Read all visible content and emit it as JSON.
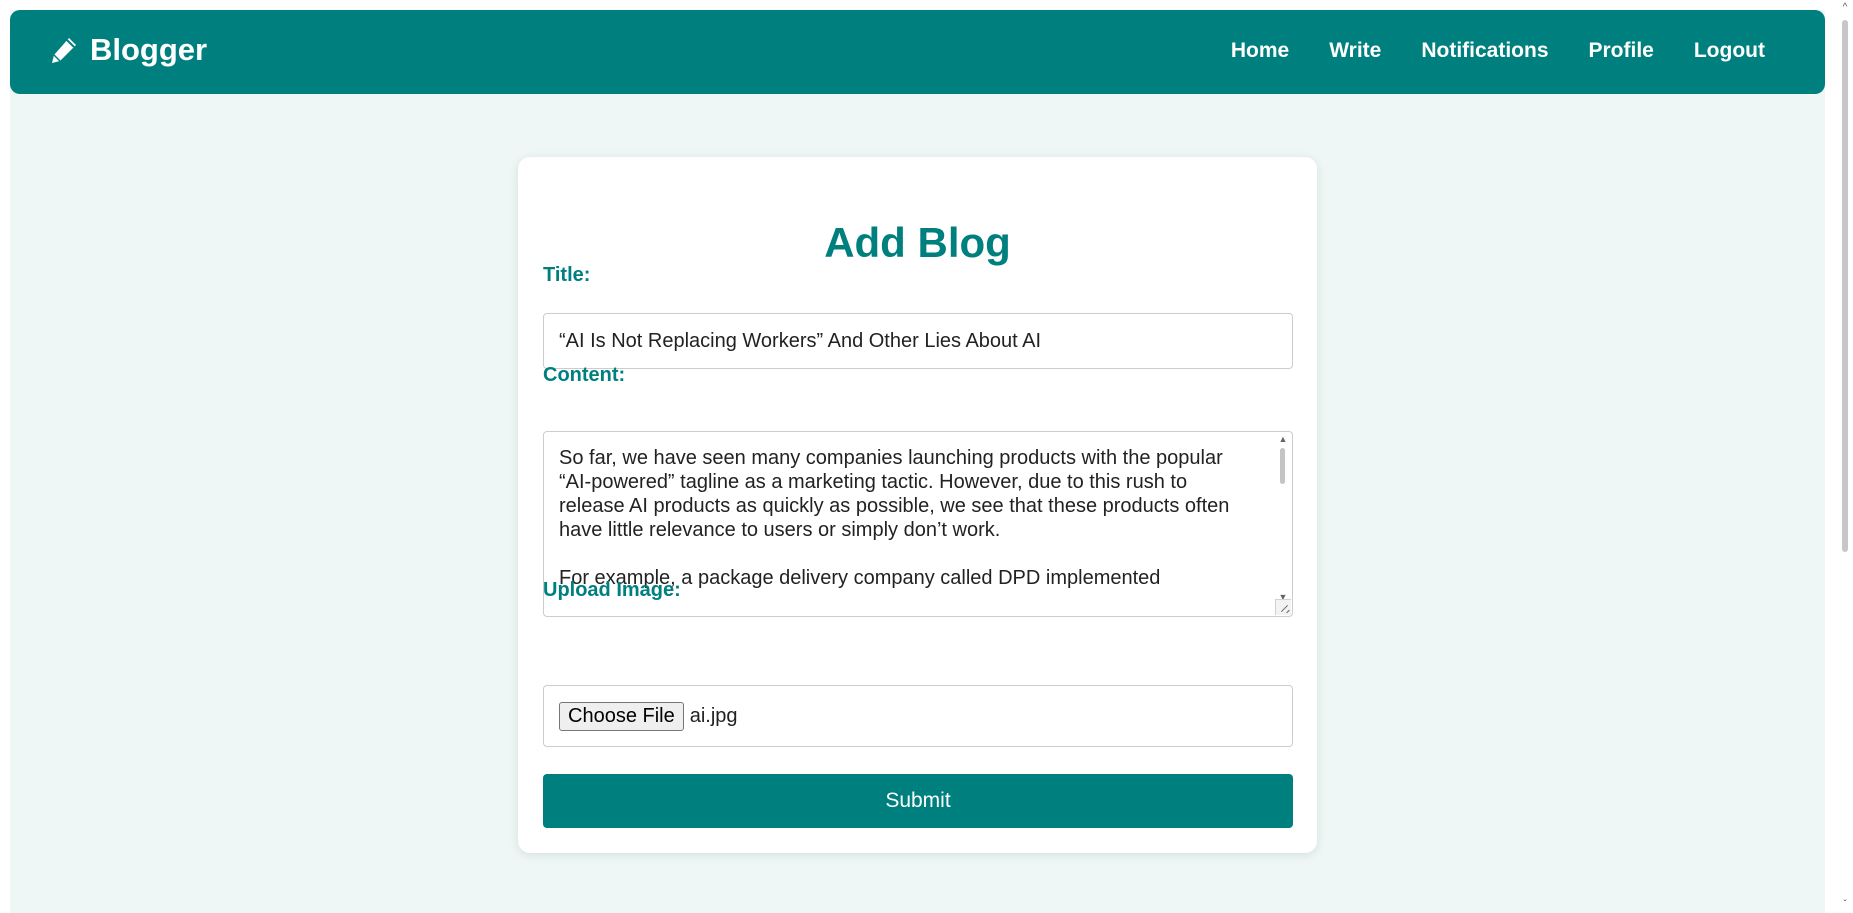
{
  "navbar": {
    "brand": "Blogger",
    "brand_icon": "pencil-icon",
    "links": [
      "Home",
      "Write",
      "Notifications",
      "Profile",
      "Logout"
    ]
  },
  "form": {
    "heading": "Add Blog",
    "title_label": "Title:",
    "title_value": "“AI Is Not Replacing Workers” And Other Lies About AI",
    "content_label": "Content:",
    "content_paragraphs": [
      "So far, we have seen many companies launching products with the popular “AI-powered” tagline as a marketing tactic. However, due to this rush to release AI products as quickly as possible, we see that these products often have little relevance to users or simply don’t work.",
      "For example, a package delivery company called DPD implemented"
    ],
    "upload_label": "Upload Image:",
    "choose_file_label": "Choose File",
    "file_name": "ai.jpg",
    "submit_label": "Submit"
  },
  "colors": {
    "accent": "#007f7f",
    "page_background": "#eef7f5",
    "card_background": "#ffffff"
  }
}
